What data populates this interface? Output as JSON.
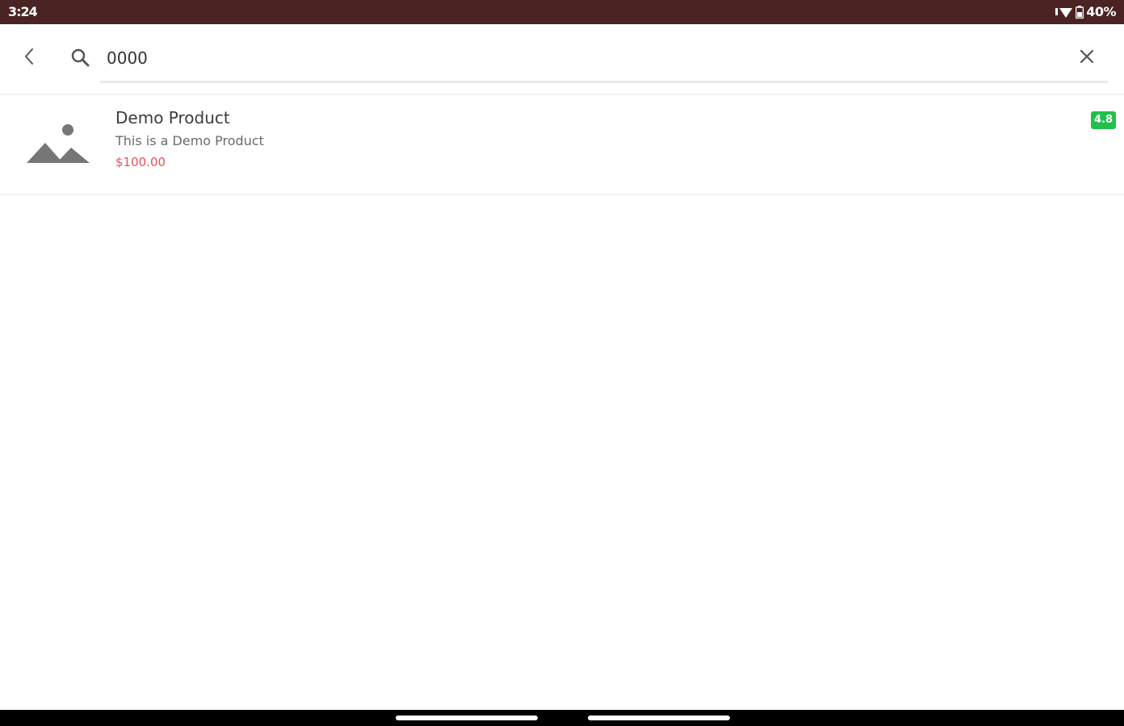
{
  "status_bar": {
    "time": "3:24",
    "battery": "40%",
    "icons": [
      "wifi-icon",
      "battery-icon"
    ]
  },
  "search": {
    "query": "0000",
    "icons": {
      "back": "back-arrow-icon",
      "search": "search-icon",
      "clear": "close-icon"
    }
  },
  "results": [
    {
      "name": "Demo Product",
      "description": "This is a Demo Product",
      "price": "$100.00",
      "rating": "4.8",
      "image": "image-placeholder-icon"
    }
  ],
  "colors": {
    "status_bar": "#4a2323",
    "price": "#e8505b",
    "rating_badge": "#22c04a"
  }
}
